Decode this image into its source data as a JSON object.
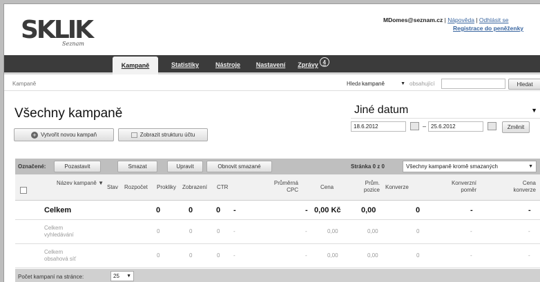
{
  "brand": {
    "logo": "SKLIK",
    "subtitle": "Seznam"
  },
  "user": {
    "email": "MDomes@seznam.cz",
    "help": "Nápověda",
    "logout": "Odhlásit se",
    "register": "Registrace do peněženky"
  },
  "nav": {
    "tabs": [
      "Kampaně",
      "Statistiky",
      "Nástroje",
      "Nastavení",
      "Zprávy"
    ],
    "messages_badge": "4"
  },
  "breadcrumb": "Kampaně",
  "search": {
    "label": "Hledat",
    "scope": "kampaně",
    "contains": "obsahující",
    "button": "Hledat"
  },
  "title": "Všechny kampaně",
  "actions": {
    "new_campaign": "Vytvořit novou kampaň",
    "account_structure": "Zobrazit strukturu účtu"
  },
  "date": {
    "range_label": "Jiné datum",
    "from": "18.6.2012",
    "to": "25.6.2012",
    "change": "Změnit"
  },
  "bulk": {
    "label": "Označené:",
    "pause": "Pozastavit",
    "delete": "Smazat",
    "edit": "Upravit",
    "restore": "Obnovit smazané",
    "page_info": "Stránka 0 z 0",
    "filter": "Všechny kampaně kromě smazaných"
  },
  "table": {
    "headers": [
      "Název kampaně",
      "Stav",
      "Rozpočet",
      "Prokliky",
      "Zobrazení",
      "CTR",
      "Průměrná CPC",
      "Cena",
      "Prům. pozice",
      "Konverze",
      "Konverzní poměr",
      "Cena konverze"
    ],
    "rows": [
      {
        "name": "Celkem",
        "budget": "0",
        "clicks": "0",
        "impressions": "0",
        "ctr": "-",
        "cpc": "-",
        "price": "0,00 Kč",
        "position": "0,00",
        "conversions": "0",
        "conv_rate": "-",
        "conv_price": "-"
      },
      {
        "name": "Celkem vyhledávání",
        "budget": "0",
        "clicks": "0",
        "impressions": "0",
        "ctr": "-",
        "cpc": "-",
        "price": "0,00",
        "position": "0,00",
        "conversions": "0",
        "conv_rate": "-",
        "conv_price": "-"
      },
      {
        "name": "Celkem obsahová síť",
        "budget": "0",
        "clicks": "0",
        "impressions": "0",
        "ctr": "-",
        "cpc": "-",
        "price": "0,00",
        "position": "0,00",
        "conversions": "0",
        "conv_rate": "-",
        "conv_price": "-"
      }
    ]
  },
  "footer": {
    "per_page_label": "Počet kampaní na stránce:",
    "per_page_value": "25"
  }
}
